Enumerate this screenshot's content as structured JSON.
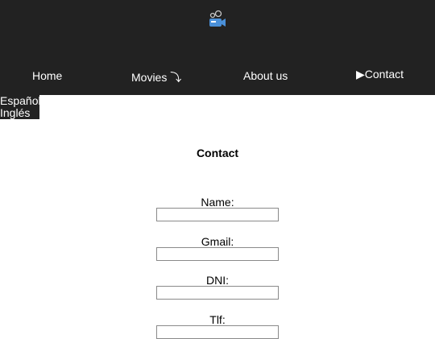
{
  "nav": {
    "home": "Home",
    "movies": "Movies ⤵",
    "about": "About us",
    "contact": "▶Contact"
  },
  "language": {
    "spanish": "Español",
    "english": "Inglés"
  },
  "page": {
    "title": "Contact"
  },
  "form": {
    "name_label": "Name:",
    "gmail_label": "Gmail:",
    "dni_label": "DNI:",
    "tlf_label": "Tlf:",
    "name_value": "",
    "gmail_value": "",
    "dni_value": "",
    "tlf_value": ""
  },
  "colors": {
    "header_bg": "#222222",
    "logo_blue": "#4a90d9"
  },
  "icons": {
    "logo": "movie-camera-icon"
  }
}
